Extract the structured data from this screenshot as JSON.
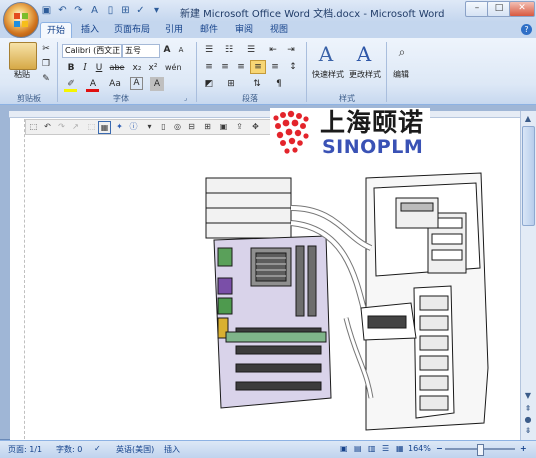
{
  "window": {
    "title": "新建 Microsoft Office Word 文档.docx - Microsoft Word",
    "controls": [
      "–",
      "□",
      "✕"
    ]
  },
  "quick_access": [
    "save-icon",
    "undo-icon",
    "redo-icon",
    "font-color-icon",
    "new-doc-icon",
    "print-preview-icon",
    "spelling-icon"
  ],
  "tabs": [
    {
      "label": "开始",
      "active": true
    },
    {
      "label": "插入"
    },
    {
      "label": "页面布局"
    },
    {
      "label": "引用"
    },
    {
      "label": "邮件"
    },
    {
      "label": "审阅"
    },
    {
      "label": "视图"
    }
  ],
  "ribbon": {
    "clipboard": {
      "label": "剪贴板",
      "paste": "粘贴"
    },
    "font": {
      "label": "字体",
      "font_name": "Calibri (西文正",
      "font_size": "五号",
      "bold": "B",
      "italic": "I",
      "underline": "U",
      "strike": "abe",
      "subscript": "x₂",
      "superscript": "x²",
      "case": "Aa",
      "grow": "A",
      "shrink": "A",
      "clear": "A",
      "phonetic": "wén",
      "border_char": "A"
    },
    "paragraph": {
      "label": "段落"
    },
    "styles": {
      "label": "样式",
      "quick_styles": "快速样式",
      "change_styles": "更改样式"
    },
    "editing": {
      "label": "编辑"
    }
  },
  "logo": {
    "cn": "上海颐诺",
    "en": "SINOPLM"
  },
  "status_bar": {
    "page": "页面: 1/1",
    "words": "字数: 0",
    "language": "英语(美国)",
    "insert_mode": "插入",
    "zoom": "164%",
    "zoom_out": "−",
    "zoom_in": "+"
  },
  "colors": {
    "accent": "#15428b",
    "ribbon_bg": "#dde8f6",
    "logo_dots": "#e3242b",
    "logo_en": "#3a52b5"
  }
}
